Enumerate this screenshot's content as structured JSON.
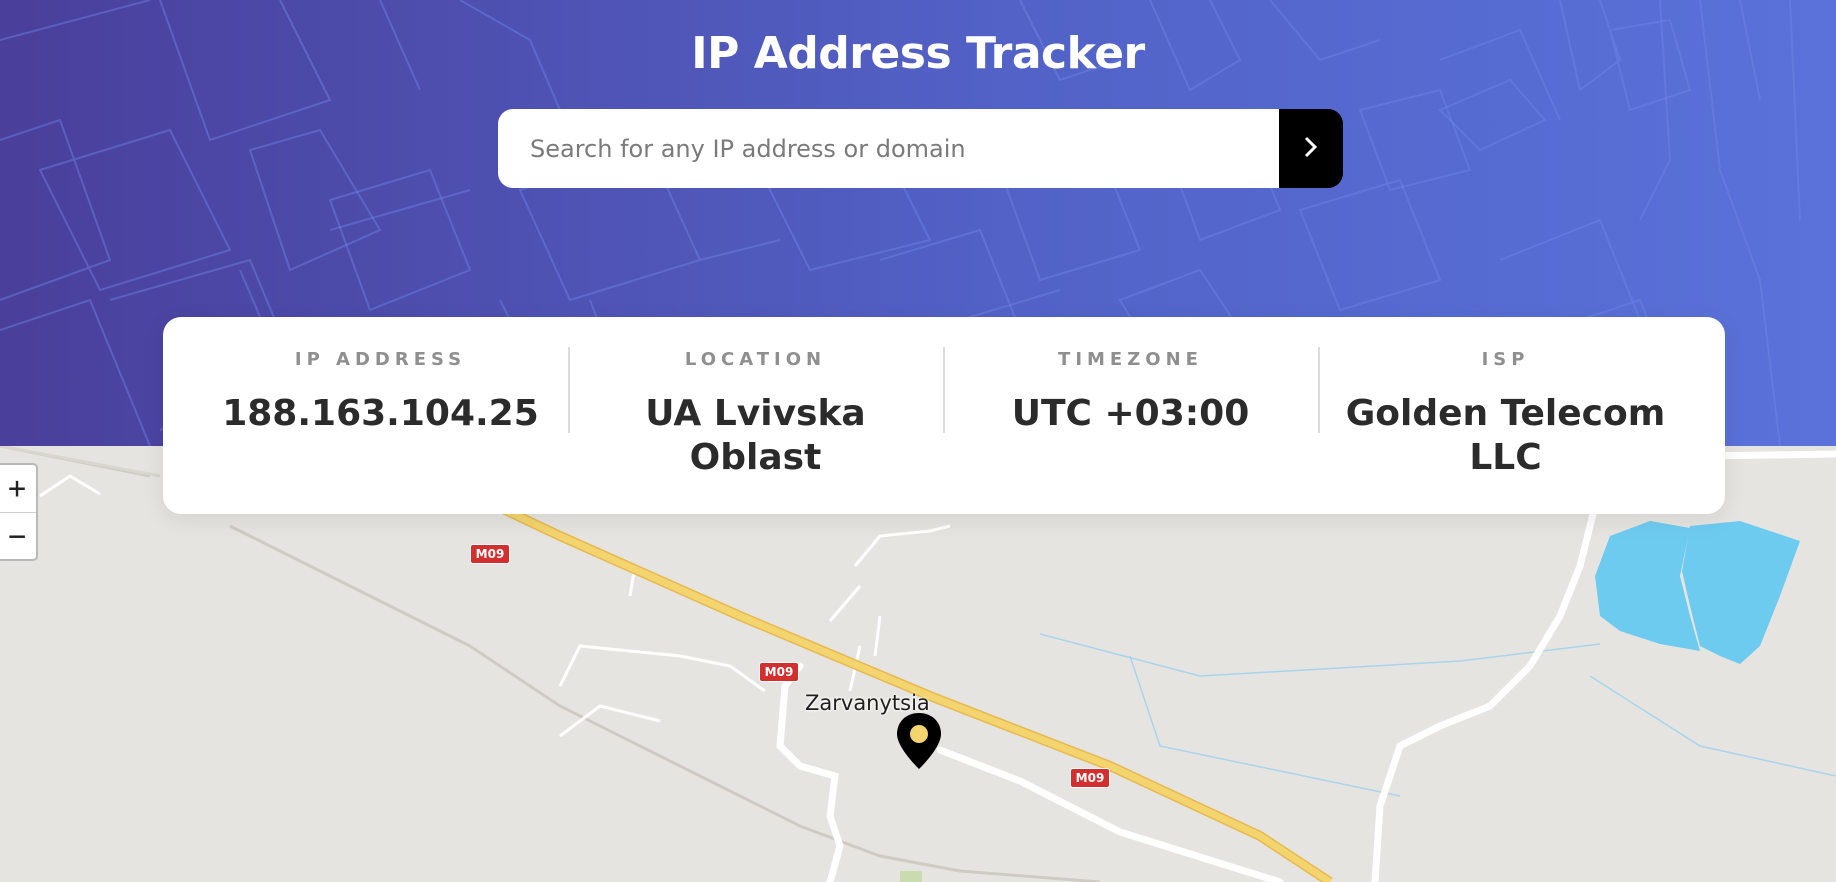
{
  "header": {
    "title": "IP Address Tracker"
  },
  "search": {
    "placeholder": "Search for any IP address or domain",
    "value": "",
    "submit_icon": "chevron-right-icon"
  },
  "info": [
    {
      "label": "IP ADDRESS",
      "value": "188.163.104.25"
    },
    {
      "label": "LOCATION",
      "value": "UA Lvivska Oblast"
    },
    {
      "label": "TIMEZONE",
      "value": "UTC +03:00"
    },
    {
      "label": "ISP",
      "value": "Golden Telecom LLC"
    }
  ],
  "map": {
    "zoom_in_label": "+",
    "zoom_out_label": "−",
    "place_label": "Zarvanytsia",
    "road_shields": [
      "M09",
      "M09",
      "M09"
    ],
    "marker_icon": "location-pin-icon"
  },
  "colors": {
    "accent": "#000000",
    "header_gradient_start": "#4a3f9b",
    "header_gradient_end": "#5a72da",
    "road_major": "#f1cc62",
    "road_shield": "#d32f2f",
    "water": "#6ecbf0"
  }
}
